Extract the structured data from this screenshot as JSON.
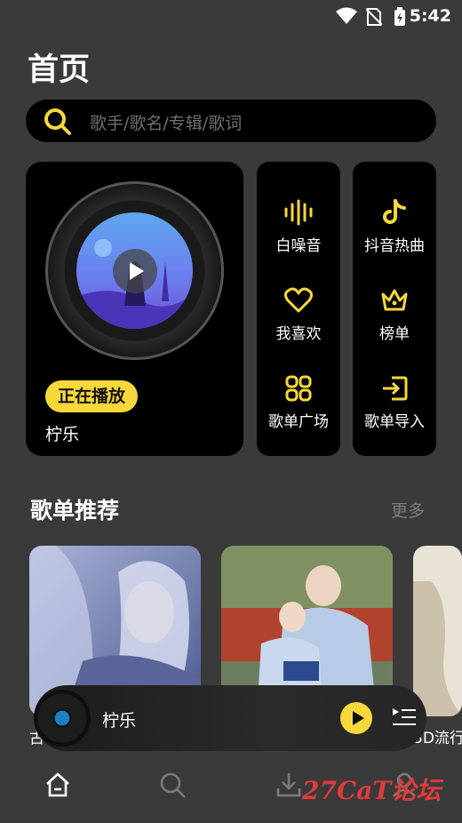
{
  "status_bar": {
    "time": "5:42"
  },
  "header": {
    "title": "首页"
  },
  "search": {
    "placeholder": "歌手/歌名/专辑/歌词"
  },
  "now_playing_card": {
    "badge": "正在播放",
    "song": "柠乐"
  },
  "quick_actions": [
    {
      "label": "白噪音",
      "icon": "sound-wave-icon"
    },
    {
      "label": "抖音热曲",
      "icon": "tiktok-icon"
    },
    {
      "label": "我喜欢",
      "icon": "heart-icon"
    },
    {
      "label": "榜单",
      "icon": "crown-icon"
    },
    {
      "label": "歌单广场",
      "icon": "grid-icon"
    },
    {
      "label": "歌单导入",
      "icon": "import-icon"
    }
  ],
  "recommend": {
    "title": "歌单推荐",
    "more": "更多",
    "playlists": [
      {
        "name": "古"
      },
      {
        "name": ""
      },
      {
        "name": "3D流行"
      }
    ]
  },
  "mini_player": {
    "title": "柠乐"
  },
  "bottom_nav": [
    {
      "icon": "home-icon"
    },
    {
      "icon": "search-icon"
    },
    {
      "icon": "download-icon"
    },
    {
      "icon": "profile-icon"
    }
  ],
  "watermark": "27CaT论坛",
  "colors": {
    "accent": "#f7d83a",
    "background": "#3a3a3a",
    "card": "#000000"
  }
}
